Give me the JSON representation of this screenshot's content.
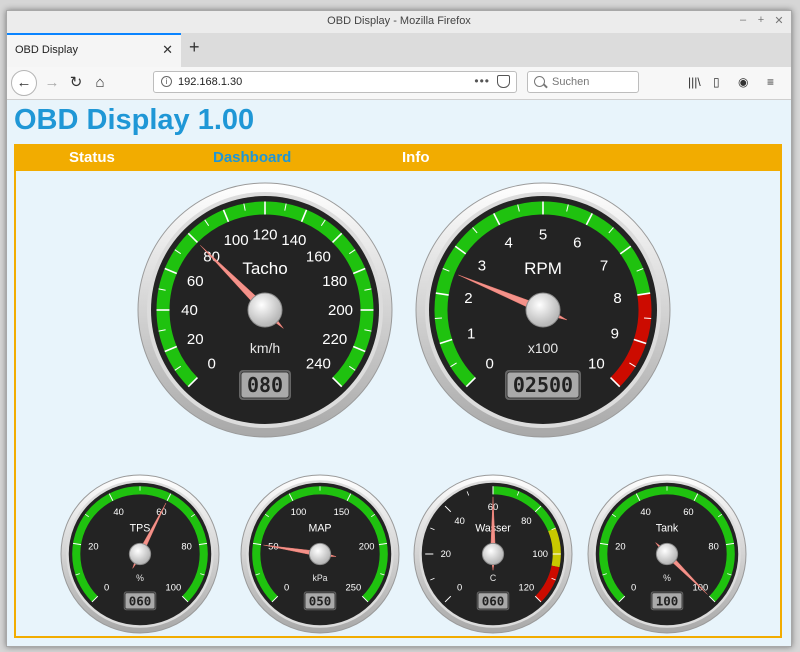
{
  "window": {
    "title": "OBD Display - Mozilla Firefox"
  },
  "tab": {
    "label": "OBD Display"
  },
  "urlbar": {
    "url": "192.168.1.30",
    "dots": "•••"
  },
  "searchbar": {
    "placeholder": "Suchen"
  },
  "page": {
    "title": "OBD Display 1.00"
  },
  "menu": {
    "items": [
      "Status",
      "Dashboard",
      "Info"
    ],
    "active": "Dashboard"
  },
  "colors": {
    "accent": "#1f97d6",
    "menu_bg": "#f2ac00",
    "green_zone": "#1fc20f",
    "red_zone": "#cc0b00",
    "yellow_zone": "#c8c800"
  },
  "gauges": [
    {
      "id": "tacho",
      "title": "Tacho",
      "unit": "km/h",
      "min": 0,
      "max": 240,
      "ticks": [
        0,
        20,
        40,
        60,
        80,
        100,
        120,
        140,
        160,
        180,
        200,
        220,
        240
      ],
      "minor": 2,
      "value": 80,
      "display": "080",
      "zones": [
        {
          "from": 0,
          "to": 240,
          "color": "#1fc20f"
        }
      ]
    },
    {
      "id": "rpm",
      "title": "RPM",
      "unit": "x100",
      "min": 0,
      "max": 10,
      "ticks": [
        0,
        1,
        2,
        3,
        4,
        5,
        6,
        7,
        8,
        9,
        10
      ],
      "minor": 2,
      "value": 2.5,
      "display": "02500",
      "zones": [
        {
          "from": 0,
          "to": 8,
          "color": "#1fc20f"
        },
        {
          "from": 8,
          "to": 10,
          "color": "#cc0b00"
        }
      ]
    },
    {
      "id": "tps",
      "title": "TPS",
      "unit": "%",
      "min": 0,
      "max": 100,
      "ticks": [
        0,
        20,
        40,
        60,
        80,
        100
      ],
      "minor": 2,
      "value": 60,
      "display": "060",
      "zones": [
        {
          "from": 0,
          "to": 100,
          "color": "#1fc20f"
        }
      ]
    },
    {
      "id": "map",
      "title": "MAP",
      "unit": "kPa",
      "min": 0,
      "max": 250,
      "ticks": [
        0,
        50,
        100,
        150,
        200,
        250
      ],
      "minor": 2,
      "value": 50,
      "display": "050",
      "zones": [
        {
          "from": 0,
          "to": 250,
          "color": "#1fc20f"
        }
      ]
    },
    {
      "id": "wasser",
      "title": "Wasser",
      "unit": "C",
      "min": 0,
      "max": 120,
      "ticks": [
        0,
        20,
        40,
        60,
        80,
        100,
        120
      ],
      "minor": 2,
      "value": 60,
      "display": "060",
      "zones": [
        {
          "from": 60,
          "to": 90,
          "color": "#1fc20f"
        },
        {
          "from": 90,
          "to": 105,
          "color": "#c8c800"
        },
        {
          "from": 105,
          "to": 120,
          "color": "#cc0b00"
        }
      ]
    },
    {
      "id": "tank",
      "title": "Tank",
      "unit": "%",
      "min": 0,
      "max": 100,
      "ticks": [
        0,
        20,
        40,
        60,
        80,
        100
      ],
      "minor": 2,
      "value": 100,
      "display": "100",
      "zones": [
        {
          "from": 0,
          "to": 100,
          "color": "#1fc20f"
        }
      ]
    }
  ]
}
